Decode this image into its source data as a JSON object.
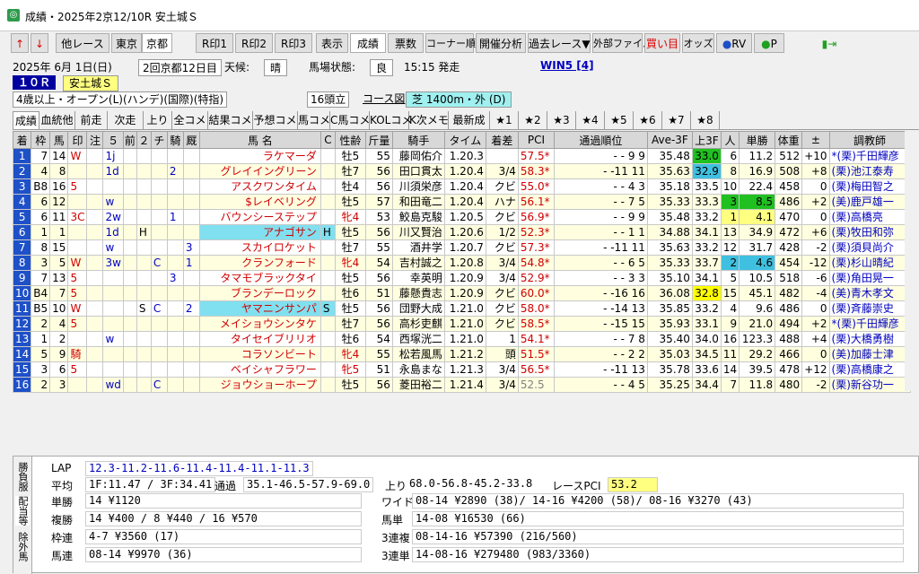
{
  "window": {
    "title": "成績・2025年2京12/10R 安土城Ｓ",
    "icon": "app-icon"
  },
  "toolbar": {
    "up_arrow": "↑",
    "down_arrow": "↓",
    "other_race": "他レース",
    "tokyo": "東京",
    "kyoto": "京都",
    "r1": "R印1",
    "r2": "R印2",
    "r3": "R印3",
    "display": "表示",
    "results": "成績",
    "votes": "票数",
    "corner": "コーナー順",
    "analysis": "開催分析",
    "past": "過去レース▼",
    "external": "外部ファイル",
    "buy": "買い目",
    "odds": "オッズ",
    "rv": "RV",
    "p": "P"
  },
  "info": {
    "date": "2025年 6月 1日(日)",
    "meeting": "2回京都12日目",
    "weather_label": "天候:",
    "weather": "晴",
    "track_label": "馬場状態:",
    "track": "良",
    "time": "15:15 発走",
    "win5": "WIN5 [4]",
    "race_no": "１０Ｒ",
    "race_name": "安土城Ｓ",
    "conditions": "4歳以上・オープン(L)(ハンデ)(国際)(特指)",
    "runners": "16頭立",
    "course_label": "コース図",
    "course": "芝 1400m・外 (D)"
  },
  "tabs": [
    "成績",
    "血統他",
    "前走",
    "次走",
    "上り",
    "全コメ",
    "結果コメ",
    "予想コメ",
    "馬コメ",
    "C馬コメ",
    "KOLコメ",
    "K次メモ",
    "最新成",
    "★1",
    "★2",
    "★3",
    "★4",
    "★5",
    "★6",
    "★7",
    "★8"
  ],
  "headers": [
    "着",
    "枠",
    "馬",
    "印",
    "注",
    "５",
    "前",
    "２",
    "チ",
    "騎",
    "厩",
    "馬 名",
    "C",
    "性齢",
    "斤量",
    "騎手",
    "タイム",
    "着差",
    "PCI",
    "通過順位",
    "Ave-3F",
    "上3F",
    "人",
    "単勝",
    "体重",
    "±",
    "調教師"
  ],
  "rows": [
    [
      "1",
      "7",
      "14",
      "W",
      "",
      "1j",
      "",
      "",
      "",
      "",
      "",
      "ラケマーダ",
      "",
      "牡5",
      "55",
      "藤岡佑介",
      "1.20.3",
      "",
      "57.5*",
      "-",
      "-",
      "9",
      "9",
      "35.48",
      "33.0",
      "6",
      "11.2",
      "512",
      "+10",
      "*(栗)千田輝彦"
    ],
    [
      "2",
      "4",
      "8",
      "",
      "",
      "1d",
      "",
      "",
      "",
      "2",
      "",
      "グレイイングリーン",
      "",
      "牡7",
      "56",
      "田口貫太",
      "1.20.4",
      "3/4",
      "58.3*",
      "-",
      "-11",
      "11",
      "",
      "35.63",
      "32.9",
      "8",
      "16.9",
      "508",
      "+8",
      "(栗)池江泰寿"
    ],
    [
      "3",
      "B8",
      "16",
      "5",
      "",
      "",
      "",
      "",
      "",
      "",
      "",
      "アスクワンタイム",
      "",
      "牡4",
      "56",
      "川須栄彦",
      "1.20.4",
      "クビ",
      "55.0*",
      "-",
      "-",
      "4",
      "3",
      "35.18",
      "33.5",
      "10",
      "22.4",
      "458",
      "0",
      "(栗)梅田智之"
    ],
    [
      "4",
      "6",
      "12",
      "",
      "",
      "w",
      "",
      "",
      "",
      "",
      "",
      "$レイベリング",
      "",
      "牡5",
      "57",
      "和田竜二",
      "1.20.4",
      "ハナ",
      "56.1*",
      "-",
      "-",
      "7",
      "5",
      "35.33",
      "33.3",
      "3",
      "8.5",
      "486",
      "+2",
      "(美)鹿戸雄一"
    ],
    [
      "5",
      "6",
      "11",
      "3C",
      "",
      "2w",
      "",
      "",
      "",
      "1",
      "",
      "バウンシーステップ",
      "",
      "牝4",
      "53",
      "鮫島克駿",
      "1.20.5",
      "クビ",
      "56.9*",
      "-",
      "-",
      "9",
      "9",
      "35.48",
      "33.2",
      "1",
      "4.1",
      "470",
      "0",
      "(栗)高橋亮"
    ],
    [
      "6",
      "1",
      "1",
      "",
      "",
      "1d",
      "",
      "H",
      "",
      "",
      "",
      "アナゴサン",
      "H",
      "牡5",
      "56",
      "川又賢治",
      "1.20.6",
      "1/2",
      "52.3*",
      "-",
      "-",
      "1",
      "1",
      "34.88",
      "34.1",
      "13",
      "34.9",
      "472",
      "+6",
      "(栗)牧田和弥"
    ],
    [
      "7",
      "8",
      "15",
      "",
      "",
      "w",
      "",
      "",
      "",
      "",
      "3",
      "スカイロケット",
      "",
      "牡7",
      "55",
      "酒井学",
      "1.20.7",
      "クビ",
      "57.3*",
      "-",
      "-11",
      "11",
      "",
      "35.63",
      "33.2",
      "12",
      "31.7",
      "428",
      "-2",
      "(栗)須貝尚介"
    ],
    [
      "8",
      "3",
      "5",
      "W",
      "",
      "3w",
      "",
      "",
      "C",
      "",
      "1",
      "クランフォード",
      "",
      "牝4",
      "54",
      "吉村誠之",
      "1.20.8",
      "3/4",
      "54.8*",
      "-",
      "-",
      "6",
      "5",
      "35.33",
      "33.7",
      "2",
      "4.6",
      "454",
      "-12",
      "(栗)杉山晴紀"
    ],
    [
      "9",
      "7",
      "13",
      "5",
      "",
      "",
      "",
      "",
      "",
      "3",
      "",
      "タマモブラックタイ",
      "",
      "牡5",
      "56",
      "幸英明",
      "1.20.9",
      "3/4",
      "52.9*",
      "-",
      "-",
      "3",
      "3",
      "35.10",
      "34.1",
      "5",
      "10.5",
      "518",
      "-6",
      "(栗)角田晃一"
    ],
    [
      "10",
      "B4",
      "7",
      "5",
      "",
      "",
      "",
      "",
      "",
      "",
      "",
      "ブランデーロック",
      "",
      "牡6",
      "51",
      "藤懸貴志",
      "1.20.9",
      "クビ",
      "60.0*",
      "-",
      "-16",
      "16",
      "",
      "36.08",
      "32.8",
      "15",
      "45.1",
      "482",
      "-4",
      "(美)青木孝文"
    ],
    [
      "11",
      "B5",
      "10",
      "W",
      "",
      "",
      "",
      "S",
      "C",
      "",
      "2",
      "ヤマニンサンパ",
      "S",
      "牡5",
      "56",
      "団野大成",
      "1.21.0",
      "クビ",
      "58.0*",
      "-",
      "-14",
      "13",
      "",
      "35.85",
      "33.2",
      "4",
      "9.6",
      "486",
      "0",
      "(栗)斉藤崇史"
    ],
    [
      "12",
      "2",
      "4",
      "5",
      "",
      "",
      "",
      "",
      "",
      "",
      "",
      "メイショウシンタケ",
      "",
      "牡7",
      "56",
      "高杉吏麒",
      "1.21.0",
      "クビ",
      "58.5*",
      "-",
      "-15",
      "15",
      "",
      "35.93",
      "33.1",
      "9",
      "21.0",
      "494",
      "+2",
      "*(栗)千田輝彦"
    ],
    [
      "13",
      "1",
      "2",
      "",
      "",
      "w",
      "",
      "",
      "",
      "",
      "",
      "タイセイブリリオ",
      "",
      "牡6",
      "54",
      "西塚洸二",
      "1.21.0",
      "1",
      "54.1*",
      "-",
      "-",
      "7",
      "8",
      "35.40",
      "34.0",
      "16",
      "123.3",
      "488",
      "+4",
      "(栗)大橋勇樹"
    ],
    [
      "14",
      "5",
      "9",
      "騎",
      "",
      "",
      "",
      "",
      "",
      "",
      "",
      "コラソンビート",
      "",
      "牝4",
      "55",
      "松若風馬",
      "1.21.2",
      "頭",
      "51.5*",
      "-",
      "-",
      "2",
      "2",
      "35.03",
      "34.5",
      "11",
      "29.2",
      "466",
      "0",
      "(美)加藤士津"
    ],
    [
      "15",
      "3",
      "6",
      "5",
      "",
      "",
      "",
      "",
      "",
      "",
      "",
      "ベイシャフラワー",
      "",
      "牝5",
      "51",
      "永島まな",
      "1.21.3",
      "3/4",
      "56.5*",
      "-",
      "-11",
      "13",
      "",
      "35.78",
      "33.6",
      "14",
      "39.5",
      "478",
      "+12",
      "(栗)高橋康之"
    ],
    [
      "16",
      "2",
      "3",
      "",
      "",
      "wd",
      "",
      "",
      "C",
      "",
      "",
      "ジョウショーホープ",
      "",
      "牡5",
      "56",
      "菱田裕二",
      "1.21.4",
      "3/4",
      "52.5",
      "-",
      "-",
      "4",
      "5",
      "35.25",
      "34.4",
      "7",
      "11.8",
      "480",
      "-2",
      "(栗)新谷功一"
    ]
  ],
  "bottom": {
    "vtabs": [
      "勝負服",
      "配当等",
      "除外馬"
    ],
    "lap_label": "LAP",
    "lap": "12.3-11.2-11.6-11.4-11.4-11.1-11.3",
    "avg_label": "平均",
    "avg": "1F:11.47 / 3F:34.41",
    "pass_label": "通過",
    "pass": "35.1-46.5-57.9-69.0",
    "agari_label": "上り",
    "agari": "68.0-56.8-45.2-33.8",
    "racepci_label": "レースPCI",
    "racepci": "53.2",
    "tan_label": "単勝",
    "tan": "14 ¥1120",
    "fuku_label": "複勝",
    "fuku": "14 ¥400 / 8 ¥440 / 16 ¥570",
    "waku_label": "枠連",
    "waku": "4-7 ¥3560 (17)",
    "umaren_label": "馬連",
    "umaren": "08-14 ¥9970 (36)",
    "wide_label": "ワイド",
    "wide": "08-14 ¥2890 (38)/ 14-16 ¥4200 (58)/ 08-16 ¥3270 (43)",
    "umatan_label": "馬単",
    "umatan": "14-08 ¥16530 (66)",
    "sanfuku_label": "3連複",
    "sanfuku": "08-14-16 ¥57390 (216/560)",
    "santan_label": "3連単",
    "santan": "14-08-16 ¥279480 (983/3360)"
  },
  "colors": {
    "waku": [
      "#ffffff",
      "#000000",
      "#e00000",
      "#1e50c8",
      "#f0e000",
      "#20a020",
      "#f08000",
      "#f080b0"
    ]
  }
}
